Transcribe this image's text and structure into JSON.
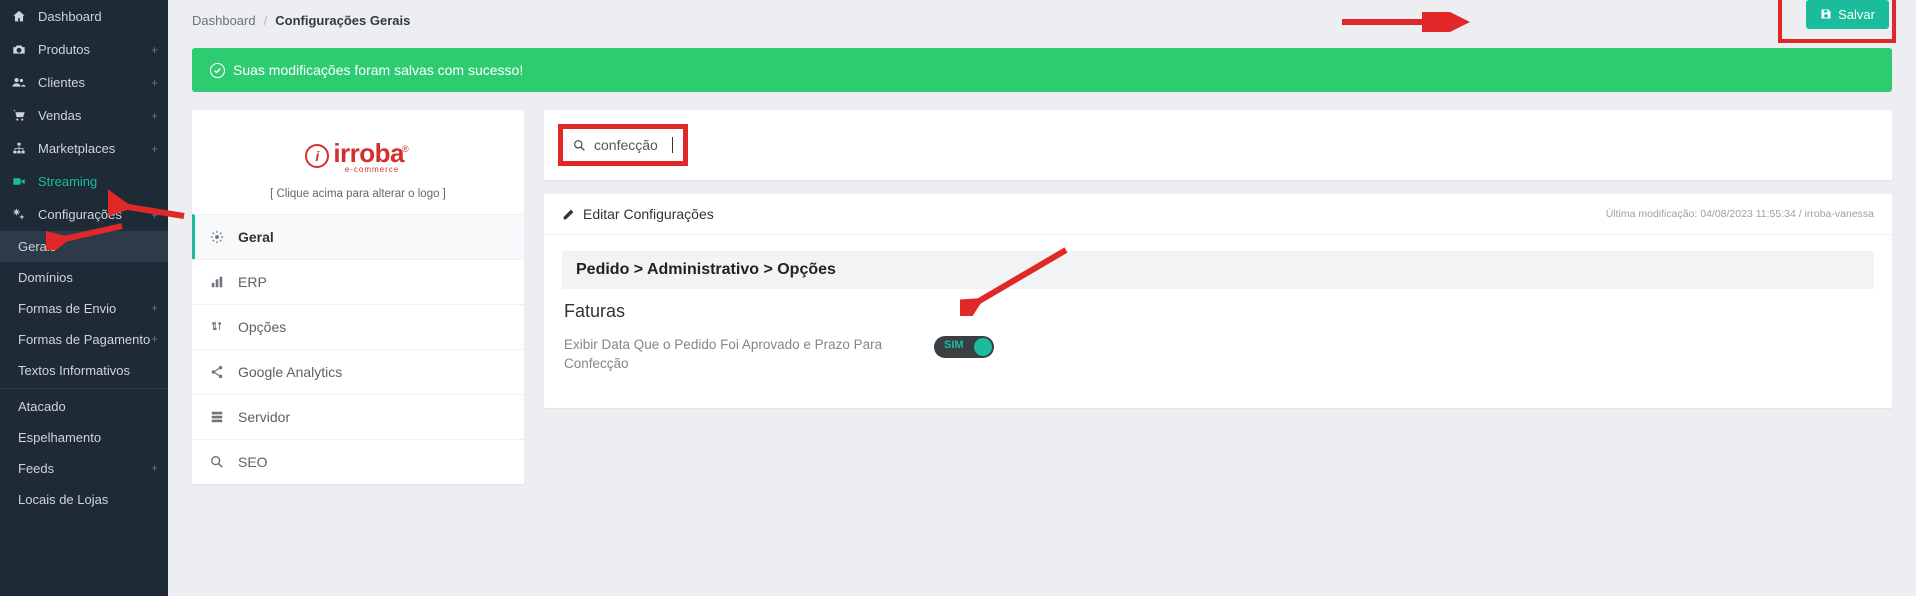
{
  "sidebar": {
    "main": [
      {
        "label": "Dashboard",
        "icon": "home",
        "expandable": false
      },
      {
        "label": "Produtos",
        "icon": "camera",
        "expandable": true
      },
      {
        "label": "Clientes",
        "icon": "users",
        "expandable": true
      },
      {
        "label": "Vendas",
        "icon": "cart",
        "expandable": true
      },
      {
        "label": "Marketplaces",
        "icon": "sitemap",
        "expandable": true
      },
      {
        "label": "Streaming",
        "icon": "video",
        "expandable": false,
        "highlight": true
      },
      {
        "label": "Configurações",
        "icon": "cogs",
        "expandable": true
      }
    ],
    "config_sub": [
      {
        "label": "Gerais",
        "active": true
      },
      {
        "label": "Domínios"
      },
      {
        "label": "Formas de Envio",
        "expandable": true
      },
      {
        "label": "Formas de Pagamento",
        "expandable": true
      },
      {
        "label": "Textos Informativos"
      },
      {
        "label": "Atacado"
      },
      {
        "label": "Espelhamento"
      },
      {
        "label": "Feeds",
        "expandable": true
      },
      {
        "label": "Locais de Lojas"
      }
    ]
  },
  "breadcrumb": {
    "root": "Dashboard",
    "current": "Configurações Gerais"
  },
  "save_button": "Salvar",
  "alert": "Suas modificações foram salvas com sucesso!",
  "logo": {
    "word": "irroba",
    "sub": "e-commerce",
    "hint": "[ Clique acima para alterar o logo ]"
  },
  "tabs": [
    {
      "label": "Geral",
      "icon": "cog",
      "active": true
    },
    {
      "label": "ERP",
      "icon": "chart"
    },
    {
      "label": "Opções",
      "icon": "sliders"
    },
    {
      "label": "Google Analytics",
      "icon": "share"
    },
    {
      "label": "Servidor",
      "icon": "server"
    },
    {
      "label": "SEO",
      "icon": "search"
    }
  ],
  "search": {
    "value": "confecção"
  },
  "config": {
    "title": "Editar Configurações",
    "meta": "Última modificação: 04/08/2023 11:55:34 / irroba-vanessa",
    "section": "Pedido > Administrativo > Opções",
    "subsection": "Faturas",
    "option_label": "Exibir Data Que o Pedido Foi Aprovado e Prazo Para Confecção",
    "toggle_on_text": "SIM",
    "toggle_state": true
  },
  "colors": {
    "accent": "#1abc9c",
    "danger": "#e02828",
    "sidebar": "#1f2a37",
    "alert": "#2ecc71",
    "brand": "#d32f2f"
  }
}
